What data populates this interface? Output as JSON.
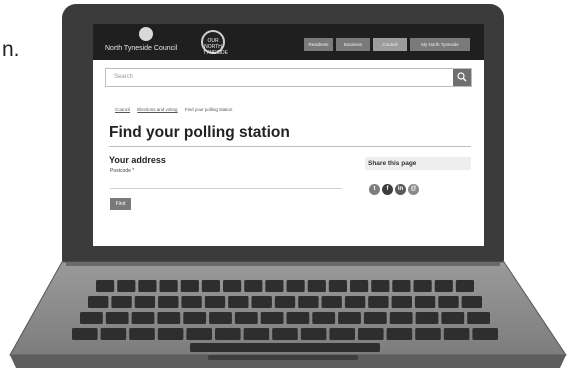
{
  "page_text": {
    "cutoff": "n."
  },
  "site": {
    "council_name": "North Tyneside Council",
    "badge_text": "OUR NORTH TYNESIDE",
    "nav": [
      "Residents",
      "Business",
      "Council",
      "My North Tyneside"
    ]
  },
  "search": {
    "placeholder": "Search"
  },
  "breadcrumb": [
    "Council",
    "Elections and voting",
    "Find your polling station"
  ],
  "main": {
    "title": "Find your polling station",
    "subtitle": "Your address",
    "postcode_label": "Postcode *",
    "find_label": "Find"
  },
  "share": {
    "title": "Share this page",
    "icons": [
      "twitter-icon",
      "facebook-icon",
      "linkedin-icon",
      "email-icon"
    ]
  },
  "colors": {
    "header": "#1f1f1f",
    "accent": "#6f6f6f",
    "laptop": "#3b3b3b"
  }
}
